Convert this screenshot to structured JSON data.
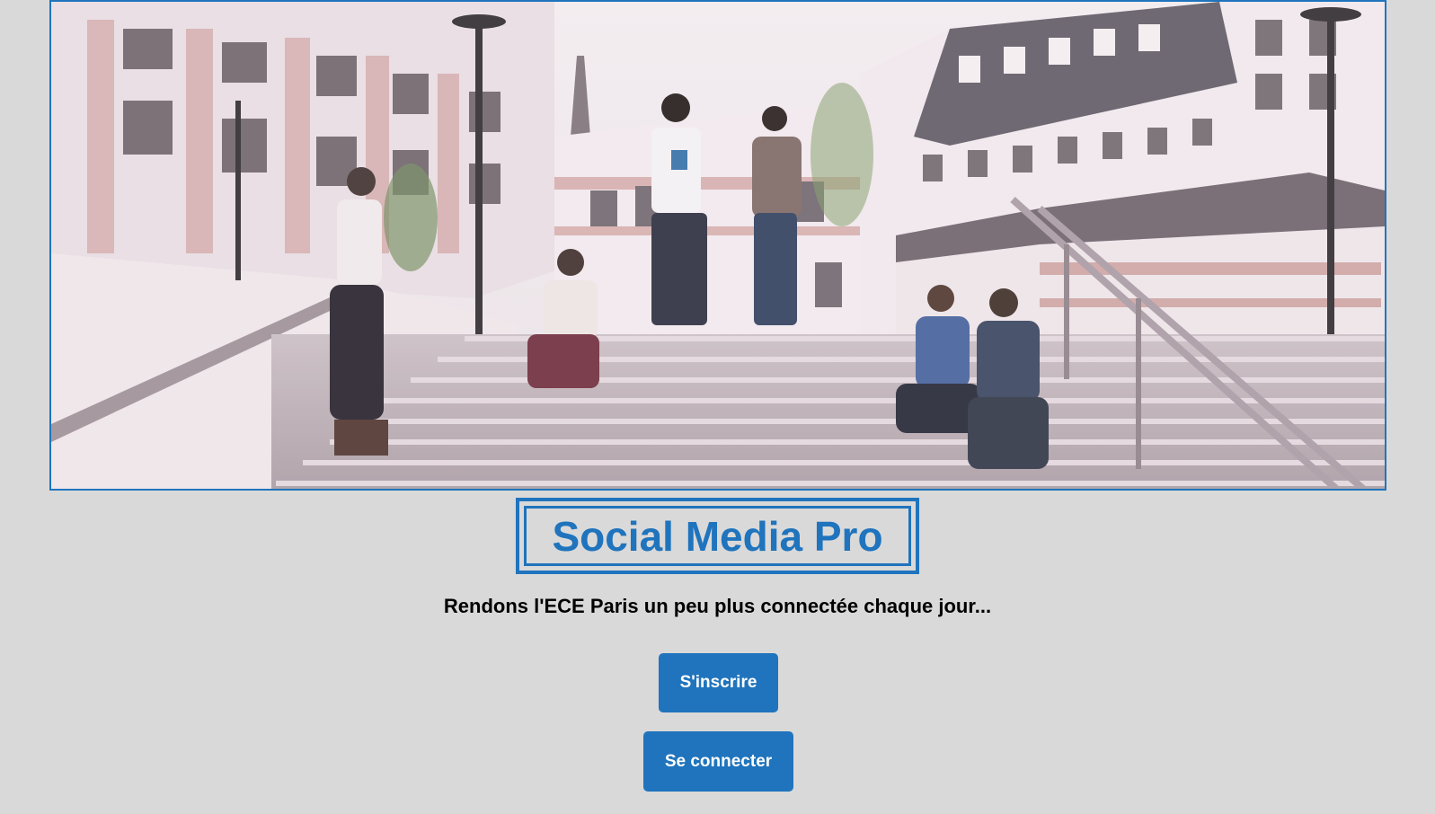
{
  "hero": {
    "image_description_icon": "students-on-campus-stairs-photo",
    "frame_color": "#1f74bd"
  },
  "brand": {
    "name": "Social Media Pro",
    "color": "#1f74bd"
  },
  "tagline": "Rendons l'ECE Paris un peu plus connectée chaque jour...",
  "buttons": {
    "signup_label": "S'inscrire",
    "login_label": "Se connecter",
    "color": "#1f74bd"
  },
  "background_color": "#d9d9d9"
}
